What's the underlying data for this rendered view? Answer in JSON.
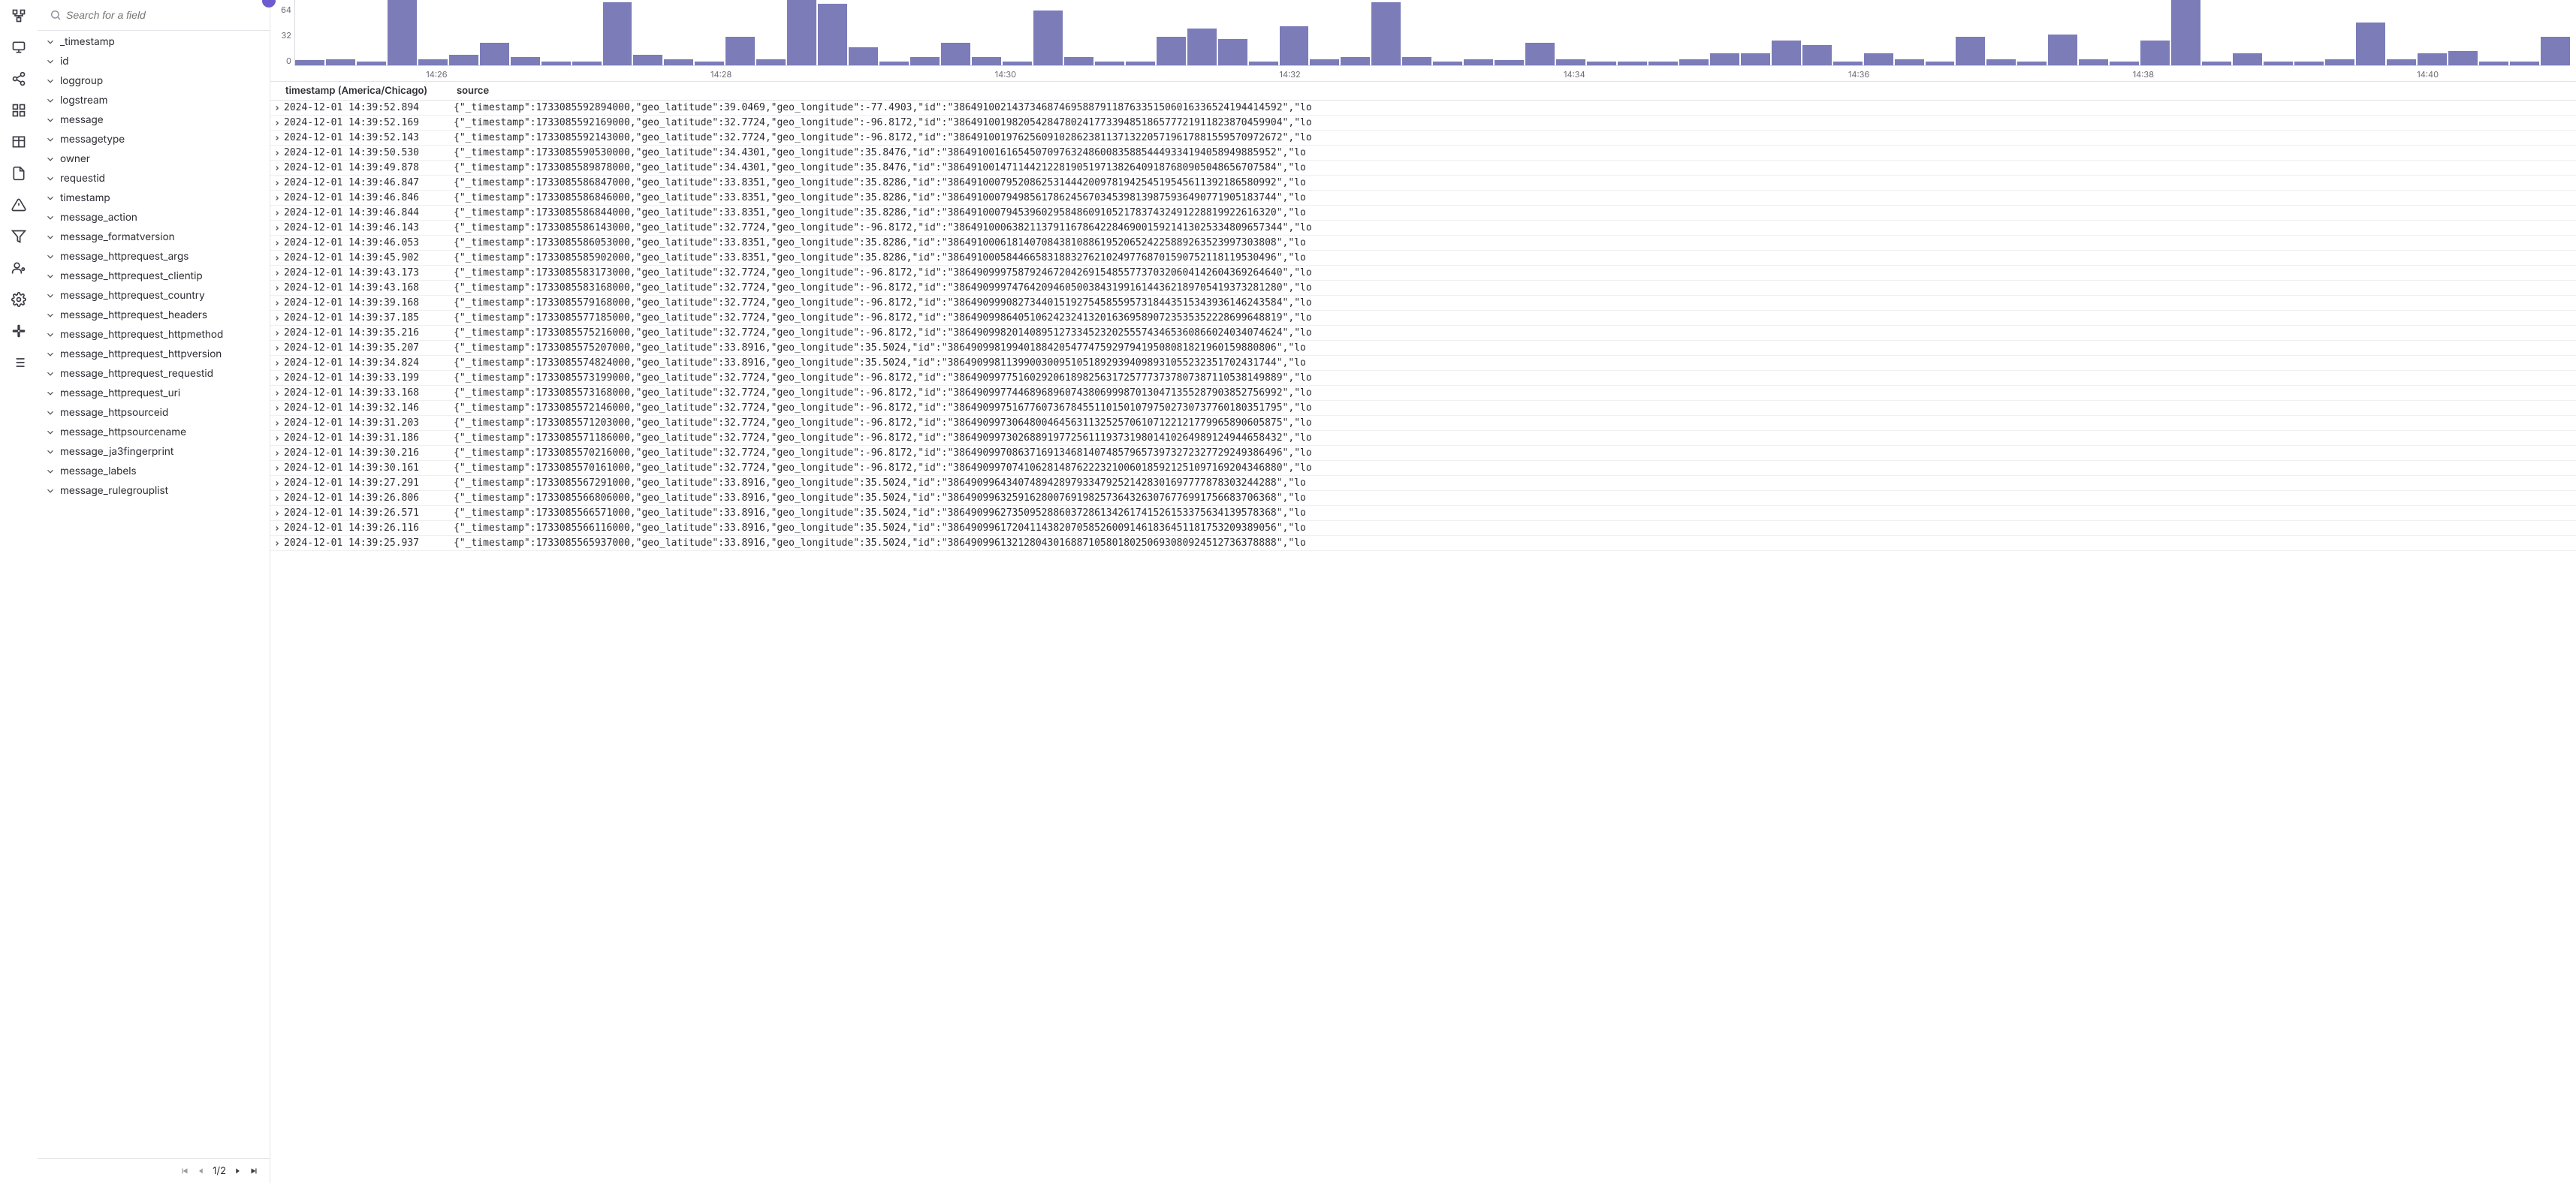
{
  "nav_icons": [
    "tree-icon",
    "monitor-icon",
    "share-icon",
    "grid-icon",
    "table-icon",
    "document-icon",
    "warning-icon",
    "filter-icon",
    "users-icon",
    "settings-icon",
    "slack-icon",
    "list-icon"
  ],
  "fields_panel": {
    "search_placeholder": "Search for a field",
    "items": [
      "_timestamp",
      "id",
      "loggroup",
      "logstream",
      "message",
      "messagetype",
      "owner",
      "requestid",
      "timestamp",
      "message_action",
      "message_formatversion",
      "message_httprequest_args",
      "message_httprequest_clientip",
      "message_httprequest_country",
      "message_httprequest_headers",
      "message_httprequest_httpmethod",
      "message_httprequest_httpversion",
      "message_httprequest_requestid",
      "message_httprequest_uri",
      "message_httpsourceid",
      "message_httpsourcename",
      "message_ja3fingerprint",
      "message_labels",
      "message_rulegrouplist"
    ],
    "pager": "1/2"
  },
  "chart_data": {
    "type": "bar",
    "ylim": [
      0,
      64
    ],
    "y_ticks": [
      "64",
      "32",
      "0"
    ],
    "x_ticks": [
      "14:26",
      "14:28",
      "14:30",
      "14:32",
      "14:34",
      "14:36",
      "14:38",
      "14:40"
    ],
    "values": [
      5,
      6,
      4,
      64,
      6,
      10,
      22,
      8,
      4,
      4,
      62,
      10,
      6,
      4,
      28,
      6,
      64,
      60,
      18,
      4,
      8,
      22,
      8,
      4,
      54,
      8,
      4,
      4,
      28,
      36,
      26,
      4,
      38,
      6,
      8,
      62,
      8,
      4,
      6,
      5,
      22,
      6,
      4,
      4,
      4,
      6,
      12,
      12,
      24,
      20,
      4,
      12,
      6,
      4,
      28,
      6,
      4,
      30,
      6,
      4,
      24,
      64,
      4,
      12,
      4,
      4,
      6,
      42,
      6,
      12,
      14,
      4,
      4,
      28
    ]
  },
  "table": {
    "columns": {
      "timestamp": "timestamp (America/Chicago)",
      "source": "source"
    },
    "rows": [
      {
        "ts": "2024-12-01 14:39:52.894",
        "src": "{\"_timestamp\":1733085592894000,\"geo_latitude\":39.0469,\"geo_longitude\":-77.4903,\"id\":\"38649100214373468746958879118763351506016336524194414592\",\"lo"
      },
      {
        "ts": "2024-12-01 14:39:52.169",
        "src": "{\"_timestamp\":1733085592169000,\"geo_latitude\":32.7724,\"geo_longitude\":-96.8172,\"id\":\"38649100198205428478024177339485186577721911823870459904\",\"lo"
      },
      {
        "ts": "2024-12-01 14:39:52.143",
        "src": "{\"_timestamp\":1733085592143000,\"geo_latitude\":32.7724,\"geo_longitude\":-96.8172,\"id\":\"38649100197625609102862381137132205719617881559570972672\",\"lo"
      },
      {
        "ts": "2024-12-01 14:39:50.530",
        "src": "{\"_timestamp\":1733085590530000,\"geo_latitude\":34.4301,\"geo_longitude\":35.8476,\"id\":\"38649100161654507097632486008358854449334194058949885952\",\"lo"
      },
      {
        "ts": "2024-12-01 14:39:49.878",
        "src": "{\"_timestamp\":1733085589878000,\"geo_latitude\":34.4301,\"geo_longitude\":35.8476,\"id\":\"38649100147114421228190519713826409187680905048656707584\",\"lo"
      },
      {
        "ts": "2024-12-01 14:39:46.847",
        "src": "{\"_timestamp\":1733085586847000,\"geo_latitude\":33.8351,\"geo_longitude\":35.8286,\"id\":\"38649100079520862531444200978194254519545611392186580992\",\"lo"
      },
      {
        "ts": "2024-12-01 14:39:46.846",
        "src": "{\"_timestamp\":1733085586846000,\"geo_latitude\":33.8351,\"geo_longitude\":35.8286,\"id\":\"38649100079498561786245670345398139875936490771905183744\",\"lo"
      },
      {
        "ts": "2024-12-01 14:39:46.844",
        "src": "{\"_timestamp\":1733085586844000,\"geo_latitude\":33.8351,\"geo_longitude\":35.8286,\"id\":\"38649100079453960295848609105217837432491228819922616320\",\"lo"
      },
      {
        "ts": "2024-12-01 14:39:46.143",
        "src": "{\"_timestamp\":1733085586143000,\"geo_latitude\":32.7724,\"geo_longitude\":-96.8172,\"id\":\"38649100063821137911678642284690015921413025334809657344\",\"lo"
      },
      {
        "ts": "2024-12-01 14:39:46.053",
        "src": "{\"_timestamp\":1733085586053000,\"geo_latitude\":33.8351,\"geo_longitude\":35.8286,\"id\":\"38649100061814070843810886195206524225889263523997303808\",\"lo"
      },
      {
        "ts": "2024-12-01 14:39:45.902",
        "src": "{\"_timestamp\":1733085585902000,\"geo_latitude\":33.8351,\"geo_longitude\":35.8286,\"id\":\"38649100058446658318832762102497768701590752118119530496\",\"lo"
      },
      {
        "ts": "2024-12-01 14:39:43.173",
        "src": "{\"_timestamp\":1733085583173000,\"geo_latitude\":32.7724,\"geo_longitude\":-96.8172,\"id\":\"38649099975879246720426915485577370320604142604369264640\",\"lo"
      },
      {
        "ts": "2024-12-01 14:39:43.168",
        "src": "{\"_timestamp\":1733085583168000,\"geo_latitude\":32.7724,\"geo_longitude\":-96.8172,\"id\":\"38649099974764209460500384319916144362189705419373281280\",\"lo"
      },
      {
        "ts": "2024-12-01 14:39:39.168",
        "src": "{\"_timestamp\":1733085579168000,\"geo_latitude\":32.7724,\"geo_longitude\":-96.8172,\"id\":\"38649099908273440151927545855957318443515343936146243584\",\"lo"
      },
      {
        "ts": "2024-12-01 14:39:37.185",
        "src": "{\"_timestamp\":1733085577185000,\"geo_latitude\":32.7724,\"geo_longitude\":-96.8172,\"id\":\"38649099864051062423241320163695890723535352228699648819\",\"lo"
      },
      {
        "ts": "2024-12-01 14:39:35.216",
        "src": "{\"_timestamp\":1733085575216000,\"geo_latitude\":32.7724,\"geo_longitude\":-96.8172,\"id\":\"38649099820140895127334523202555743465360866024034074624\",\"lo"
      },
      {
        "ts": "2024-12-01 14:39:35.207",
        "src": "{\"_timestamp\":1733085575207000,\"geo_latitude\":33.8916,\"geo_longitude\":35.5024,\"id\":\"38649099819940188420547747592979419508081821960159880806\",\"lo"
      },
      {
        "ts": "2024-12-01 14:39:34.824",
        "src": "{\"_timestamp\":1733085574824000,\"geo_latitude\":33.8916,\"geo_longitude\":35.5024,\"id\":\"38649099811399003009510518929394098931055232351702431744\",\"lo"
      },
      {
        "ts": "2024-12-01 14:39:33.199",
        "src": "{\"_timestamp\":1733085573199000,\"geo_latitude\":32.7724,\"geo_longitude\":-96.8172,\"id\":\"38649099775160292061898256317257773737807387110538149889\",\"lo"
      },
      {
        "ts": "2024-12-01 14:39:33.168",
        "src": "{\"_timestamp\":1733085573168000,\"geo_latitude\":32.7724,\"geo_longitude\":-96.8172,\"id\":\"38649099774468968960743806999870130471355287903852756992\",\"lo"
      },
      {
        "ts": "2024-12-01 14:39:32.146",
        "src": "{\"_timestamp\":1733085572146000,\"geo_latitude\":32.7724,\"geo_longitude\":-96.8172,\"id\":\"38649099751677607367845511015010797502730737760180351795\",\"lo"
      },
      {
        "ts": "2024-12-01 14:39:31.203",
        "src": "{\"_timestamp\":1733085571203000,\"geo_latitude\":32.7724,\"geo_longitude\":-96.8172,\"id\":\"38649099730648004645631132525706107122121779965890605875\",\"lo"
      },
      {
        "ts": "2024-12-01 14:39:31.186",
        "src": "{\"_timestamp\":1733085571186000,\"geo_latitude\":32.7724,\"geo_longitude\":-96.8172,\"id\":\"38649099730268891977256111937319801410264989124944658432\",\"lo"
      },
      {
        "ts": "2024-12-01 14:39:30.216",
        "src": "{\"_timestamp\":1733085570216000,\"geo_latitude\":32.7724,\"geo_longitude\":-96.8172,\"id\":\"38649099708637169134681407485796573973272327729249386496\",\"lo"
      },
      {
        "ts": "2024-12-01 14:39:30.161",
        "src": "{\"_timestamp\":1733085570161000,\"geo_latitude\":32.7724,\"geo_longitude\":-96.8172,\"id\":\"38649099707410628148762223210060185921251097169204346880\",\"lo"
      },
      {
        "ts": "2024-12-01 14:39:27.291",
        "src": "{\"_timestamp\":1733085567291000,\"geo_latitude\":33.8916,\"geo_longitude\":35.5024,\"id\":\"38649099643407489428979334792521428301697777878303244288\",\"lo"
      },
      {
        "ts": "2024-12-01 14:39:26.806",
        "src": "{\"_timestamp\":1733085566806000,\"geo_latitude\":33.8916,\"geo_longitude\":35.5024,\"id\":\"38649099632591628007691982573643263076776991756683706368\",\"lo"
      },
      {
        "ts": "2024-12-01 14:39:26.571",
        "src": "{\"_timestamp\":1733085566571000,\"geo_latitude\":33.8916,\"geo_longitude\":35.5024,\"id\":\"38649099627350952886037286134261741526153375634139578368\",\"lo"
      },
      {
        "ts": "2024-12-01 14:39:26.116",
        "src": "{\"_timestamp\":1733085566116000,\"geo_latitude\":33.8916,\"geo_longitude\":35.5024,\"id\":\"38649099617204114382070585260091461836451181753209389056\",\"lo"
      },
      {
        "ts": "2024-12-01 14:39:25.937",
        "src": "{\"_timestamp\":1733085565937000,\"geo_latitude\":33.8916,\"geo_longitude\":35.5024,\"id\":\"38649099613212804301688710580180250693080924512736378888\",\"lo"
      }
    ]
  }
}
